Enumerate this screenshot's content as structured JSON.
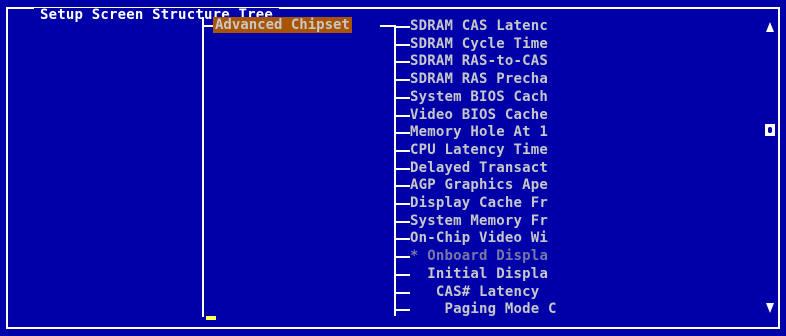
{
  "window": {
    "title": "Setup Screen Structure Tree"
  },
  "tree": {
    "selected_node": "Advanced Chipset",
    "children": [
      {
        "label": "SDRAM CAS Latenc",
        "prefix": "",
        "enabled": true
      },
      {
        "label": "SDRAM Cycle Time",
        "prefix": "",
        "enabled": true
      },
      {
        "label": "SDRAM RAS-to-CAS",
        "prefix": "",
        "enabled": true
      },
      {
        "label": "SDRAM RAS Precha",
        "prefix": "",
        "enabled": true
      },
      {
        "label": "System BIOS Cach",
        "prefix": "",
        "enabled": true
      },
      {
        "label": "Video BIOS Cache",
        "prefix": "",
        "enabled": true
      },
      {
        "label": "Memory Hole At 1",
        "prefix": "",
        "enabled": true
      },
      {
        "label": "CPU Latency Time",
        "prefix": "",
        "enabled": true
      },
      {
        "label": "Delayed Transact",
        "prefix": "",
        "enabled": true
      },
      {
        "label": "AGP Graphics Ape",
        "prefix": "",
        "enabled": true
      },
      {
        "label": "Display Cache Fr",
        "prefix": "",
        "enabled": true
      },
      {
        "label": "System Memory Fr",
        "prefix": "",
        "enabled": true
      },
      {
        "label": "On-Chip Video Wi",
        "prefix": "",
        "enabled": true
      },
      {
        "label": "Onboard Displa",
        "prefix": "* ",
        "enabled": false
      },
      {
        "label": "Initial Displa",
        "prefix": "  ",
        "enabled": true
      },
      {
        "label": "CAS# Latency",
        "prefix": "   ",
        "enabled": true
      },
      {
        "label": "Paging Mode C",
        "prefix": "    ",
        "enabled": true
      }
    ]
  },
  "colors": {
    "background": "#0000a8",
    "foreground": "#ffffff",
    "highlight": "#a85400",
    "text_gray": "#c8c8c8",
    "disabled": "#7878a8",
    "cursor": "#ffff54"
  },
  "scrollbar": {
    "up_icon": "arrow-up-icon",
    "down_icon": "arrow-down-icon",
    "position_fraction": 0.38
  }
}
